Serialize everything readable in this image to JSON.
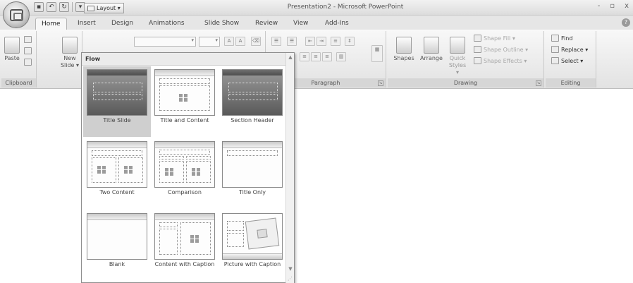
{
  "window": {
    "title": "Presentation2 - Microsoft PowerPoint",
    "controls": [
      "-",
      "▫",
      "x"
    ]
  },
  "qat": {
    "save_icon": "save-icon",
    "undo_label": "↶",
    "redo_label": "↻"
  },
  "tabs": [
    "Home",
    "Insert",
    "Design",
    "Animations",
    "Slide Show",
    "Review",
    "View",
    "Add-Ins"
  ],
  "ribbon": {
    "clipboard": {
      "label": "Clipboard",
      "paste": "Paste",
      "launcher": "⌐"
    },
    "slides": {
      "new_slide": "New Slide ▾",
      "layout": "Layout ▾"
    },
    "paragraph": {
      "label": "Paragraph"
    },
    "drawing": {
      "label": "Drawing",
      "shapes": "Shapes",
      "arrange": "Arrange",
      "quick_styles": "Quick Styles ▾",
      "shape_fill": "Shape Fill ▾",
      "shape_outline": "Shape Outline ▾",
      "shape_effects": "Shape Effects ▾"
    },
    "editing": {
      "label": "Editing",
      "find": "Find",
      "replace": "Replace ▾",
      "select": "Select ▾"
    }
  },
  "layout_dropdown": {
    "header": "Flow",
    "layouts": [
      {
        "label": "Title Slide",
        "selected": true
      },
      {
        "label": "Title and Content",
        "selected": false
      },
      {
        "label": "Section Header",
        "selected": false
      },
      {
        "label": "Two Content",
        "selected": false
      },
      {
        "label": "Comparison",
        "selected": false
      },
      {
        "label": "Title Only",
        "selected": false
      },
      {
        "label": "Blank",
        "selected": false
      },
      {
        "label": "Content with Caption",
        "selected": false
      },
      {
        "label": "Picture with Caption",
        "selected": false
      }
    ]
  }
}
